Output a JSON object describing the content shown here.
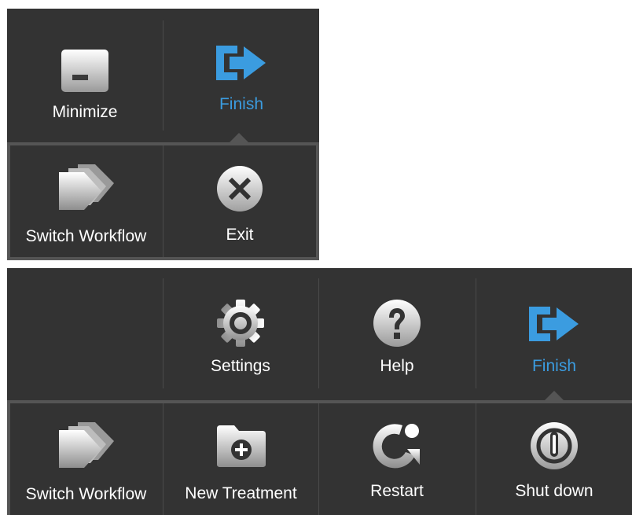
{
  "menu_small": {
    "top_items": [
      {
        "label": "Minimize",
        "icon": "minimize-icon"
      },
      {
        "label": "Finish",
        "icon": "finish-icon",
        "active": true
      }
    ],
    "drawer_items": [
      {
        "label": "Switch Workflow",
        "icon": "switch-workflow-icon"
      },
      {
        "label": "Exit",
        "icon": "exit-icon"
      }
    ]
  },
  "menu_large": {
    "top_items": [
      {
        "label": "Settings",
        "icon": "gear-icon"
      },
      {
        "label": "Help",
        "icon": "help-icon"
      },
      {
        "label": "Finish",
        "icon": "finish-icon",
        "active": true
      }
    ],
    "drawer_items": [
      {
        "label": "Switch Workflow",
        "icon": "switch-workflow-icon"
      },
      {
        "label": "New Treatment",
        "icon": "new-treatment-folder-icon"
      },
      {
        "label": "Restart",
        "icon": "restart-icon"
      },
      {
        "label": "Shut down",
        "icon": "power-icon"
      }
    ]
  },
  "colors": {
    "panel_bg": "#333333",
    "drawer_border": "#555555",
    "accent": "#3b9ce0",
    "text": "#ffffff"
  }
}
